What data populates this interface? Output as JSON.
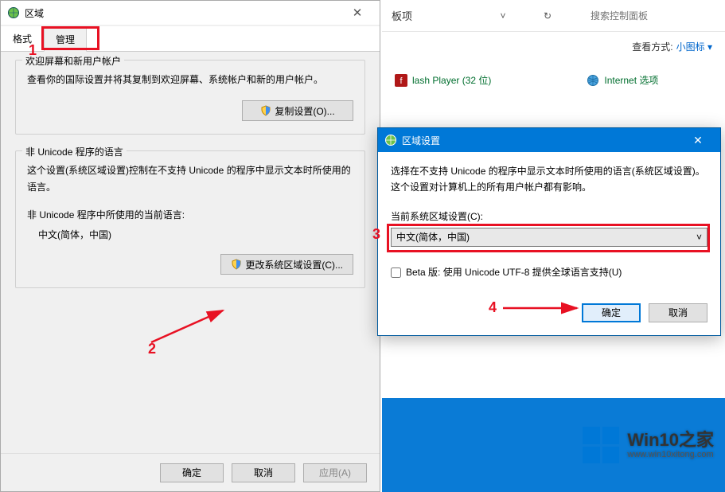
{
  "cp": {
    "breadcrumb": "板项",
    "search_placeholder": "搜索控制面板",
    "view_label": "查看方式:",
    "view_value": "小图标 ▾",
    "items": [
      {
        "label": "lash Player (32 位)",
        "icon": "flash-icon"
      },
      {
        "label": "Internet 选项",
        "icon": "internet-icon"
      }
    ]
  },
  "region": {
    "title": "区域",
    "tabs": {
      "format": "格式",
      "admin": "管理"
    },
    "group1": {
      "title": "欢迎屏幕和新用户帐户",
      "text": "查看你的国际设置并将其复制到欢迎屏幕、系统帐户和新的用户帐户。",
      "button": "复制设置(O)..."
    },
    "group2": {
      "title": "非 Unicode 程序的语言",
      "text": "这个设置(系统区域设置)控制在不支持 Unicode 的程序中显示文本时所使用的语言。",
      "sub_label": "非 Unicode 程序中所使用的当前语言:",
      "sub_value": "中文(简体，中国)",
      "button": "更改系统区域设置(C)..."
    },
    "footer": {
      "ok": "确定",
      "cancel": "取消",
      "apply": "应用(A)"
    }
  },
  "locale": {
    "title": "区域设置",
    "text": "选择在不支持 Unicode 的程序中显示文本时所使用的语言(系统区域设置)。这个设置对计算机上的所有用户帐户都有影响。",
    "label": "当前系统区域设置(C):",
    "value": "中文(简体，中国)",
    "checkbox": "Beta 版: 使用 Unicode UTF-8 提供全球语言支持(U)",
    "ok": "确定",
    "cancel": "取消"
  },
  "watermark": {
    "big": "Win10之家",
    "small": "www.win10xitong.com"
  },
  "anno": {
    "n1": "1",
    "n2": "2",
    "n3": "3",
    "n4": "4"
  }
}
